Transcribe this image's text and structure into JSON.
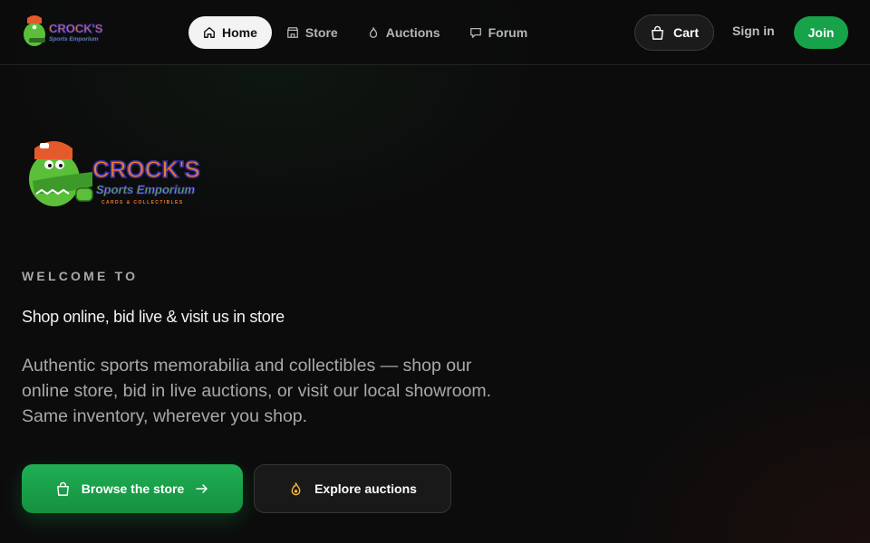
{
  "brand": {
    "logo_text": "CROCK'S",
    "logo_subtext": "Sports Emporium",
    "logo_tagline": "CARDS & COLLECTIBLES",
    "logo_icon": "alligator-mascot-logo"
  },
  "nav": {
    "items": [
      {
        "label": "Home",
        "icon": "home-icon",
        "active": true
      },
      {
        "label": "Store",
        "icon": "store-icon",
        "active": false
      },
      {
        "label": "Auctions",
        "icon": "flame-icon",
        "active": false
      },
      {
        "label": "Forum",
        "icon": "chat-icon",
        "active": false
      }
    ]
  },
  "actions": {
    "cart_label": "Cart",
    "cart_icon": "shopping-bag-icon",
    "signin_label": "Sign in",
    "join_label": "Join"
  },
  "hero": {
    "eyebrow": "WELCOME TO",
    "headline": "Shop online, bid live & visit us in store",
    "lead": "Authentic sports memorabilia and collectibles — shop our online store, bid in live auctions, or visit our local showroom. Same inventory, wherever you shop.",
    "primary_cta": "Browse the store",
    "secondary_cta": "Explore auctions"
  },
  "colors": {
    "background": "#0c0c0c",
    "accent_green": "#16a34a",
    "logo_orange": "#f07a2a",
    "logo_purple": "#3a2fa8"
  }
}
